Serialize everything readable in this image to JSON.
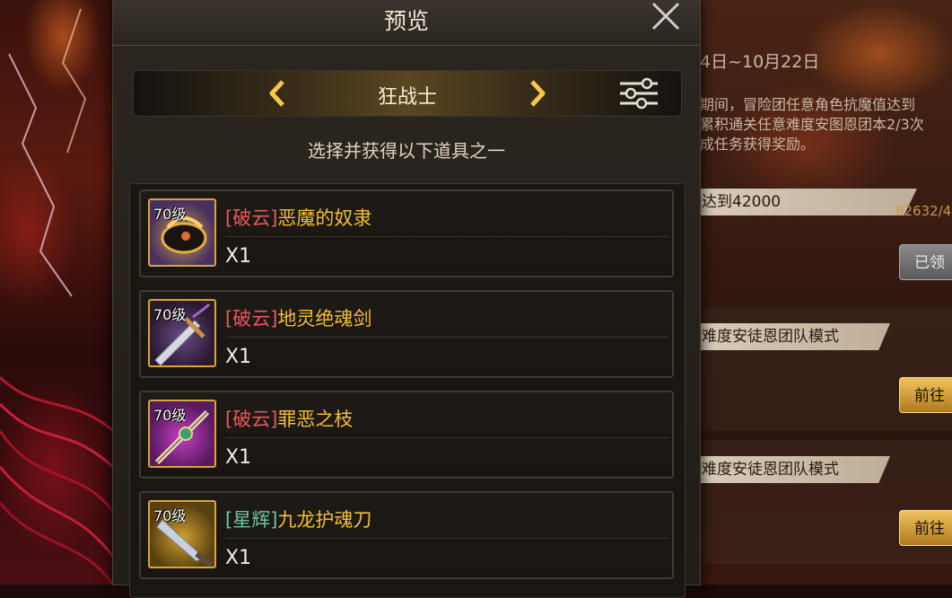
{
  "modal": {
    "title": "预览",
    "class_name": "狂战士",
    "subtitle": "选择并获得以下道具之一"
  },
  "items": [
    {
      "level": "70级",
      "prefix": "[破云]",
      "name": "恶魔的奴隶",
      "qty": "X1",
      "prefix_color": "#e8595a"
    },
    {
      "level": "70级",
      "prefix": "[破云]",
      "name": "地灵绝魂剑",
      "qty": "X1",
      "prefix_color": "#e8595a"
    },
    {
      "level": "70级",
      "prefix": "[破云]",
      "name": "罪恶之枝",
      "qty": "X1",
      "prefix_color": "#e8595a"
    },
    {
      "level": "70级",
      "prefix": "[星辉]",
      "name": "九龙护魂刀",
      "qty": "X1",
      "prefix_color": "#6fc59a"
    }
  ],
  "background": {
    "event_date": "4日~10月22日",
    "event_desc": "期间，冒险团任意角色抗魔值达到\n累积通关任意难度安图恩团本2/3次\n成任务获得奖励。",
    "tasks": [
      {
        "label": "达到42000",
        "progress": "82632/4",
        "button": "已领"
      },
      {
        "label": "难度安徒恩团队模式",
        "button": "前往"
      },
      {
        "label": "难度安徒恩团队模式",
        "button": "前往"
      }
    ]
  },
  "colors": {
    "accent_gold": "#f4bd38",
    "prefix_red": "#e8595a",
    "prefix_green": "#6fc59a",
    "icon_border": "#d8a43a"
  }
}
